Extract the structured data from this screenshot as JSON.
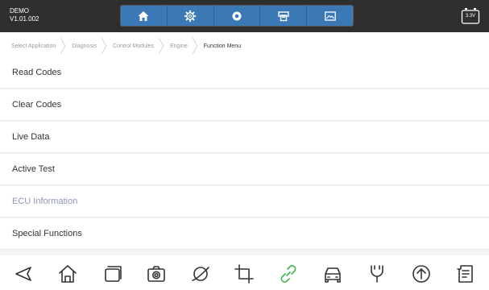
{
  "app": {
    "name": "DEMO",
    "version": "V1.01.002"
  },
  "toolbar": {
    "icons": [
      "home-icon",
      "settings-gear-icon",
      "record-icon",
      "printer-icon",
      "image-icon"
    ]
  },
  "battery": {
    "label": "3.3V"
  },
  "breadcrumb": [
    {
      "label": "Select Application"
    },
    {
      "label": "Diagnosis"
    },
    {
      "label": "Control Modules"
    },
    {
      "label": "Engine"
    },
    {
      "label": "Function Menu"
    }
  ],
  "menu": {
    "items": [
      {
        "label": "Read Codes",
        "enabled": true
      },
      {
        "label": "Clear Codes",
        "enabled": true
      },
      {
        "label": "Live Data",
        "enabled": true
      },
      {
        "label": "Active Test",
        "enabled": true
      },
      {
        "label": "ECU Information",
        "enabled": false
      },
      {
        "label": "Special Functions",
        "enabled": true
      }
    ]
  },
  "bottombar": {
    "icons": [
      "back-icon",
      "home-icon",
      "recent-apps-icon",
      "camera-icon",
      "browser-icon",
      "crop-icon",
      "link-icon",
      "car-icon",
      "vci-icon",
      "upload-icon",
      "report-icon"
    ],
    "accent_color": "#39b54a"
  },
  "colors": {
    "topbar": "#2f2f2f",
    "toolbar": "#3a78b6",
    "disabled_text": "#8d96b6"
  }
}
